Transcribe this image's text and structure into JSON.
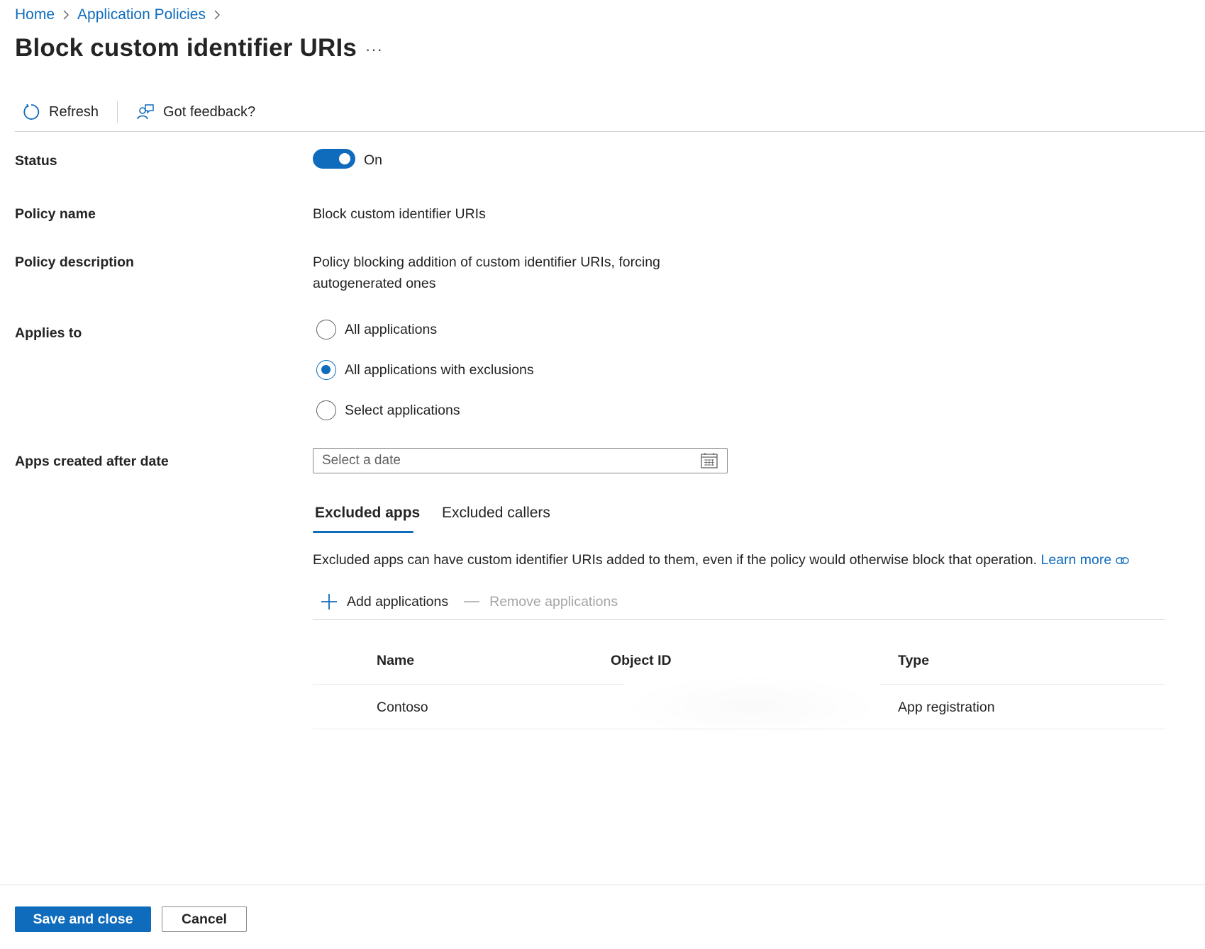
{
  "breadcrumb": {
    "items": [
      {
        "label": "Home"
      },
      {
        "label": "Application Policies"
      }
    ]
  },
  "header": {
    "title": "Block custom identifier URIs",
    "more": "···"
  },
  "toolbar": {
    "refresh_label": "Refresh",
    "feedback_label": "Got feedback?"
  },
  "form": {
    "status_label": "Status",
    "status_value": "On",
    "status_on": true,
    "policy_name_label": "Policy name",
    "policy_name_value": "Block custom identifier URIs",
    "policy_description_label": "Policy description",
    "policy_description_line1": "Policy blocking addition of custom identifier URIs, forcing",
    "policy_description_line2": "autogenerated ones",
    "applies_to_label": "Applies to",
    "applies_to_options": [
      {
        "label": "All applications",
        "checked": false
      },
      {
        "label": "All applications with exclusions",
        "checked": true
      },
      {
        "label": "Select applications",
        "checked": false
      }
    ],
    "apps_created_after_label": "Apps created after date",
    "date_value": "",
    "date_placeholder": "Select a date"
  },
  "tabs": [
    {
      "label": "Excluded apps",
      "active": true
    },
    {
      "label": "Excluded callers",
      "active": false
    }
  ],
  "excluded_apps": {
    "description": "Excluded apps can have custom identifier URIs added to them, even if the policy would otherwise block that operation.",
    "learn_more": "Learn more",
    "add_label": "Add applications",
    "remove_label": "Remove applications",
    "columns": [
      "Name",
      "Object ID",
      "Type"
    ],
    "rows": [
      {
        "name": "Contoso",
        "object_id": "",
        "type": "App registration"
      }
    ]
  },
  "footer": {
    "save_label": "Save and close",
    "cancel_label": "Cancel"
  },
  "colors": {
    "accent": "#0f6cbd",
    "text": "#242424",
    "disabled": "#a6a6a6"
  }
}
